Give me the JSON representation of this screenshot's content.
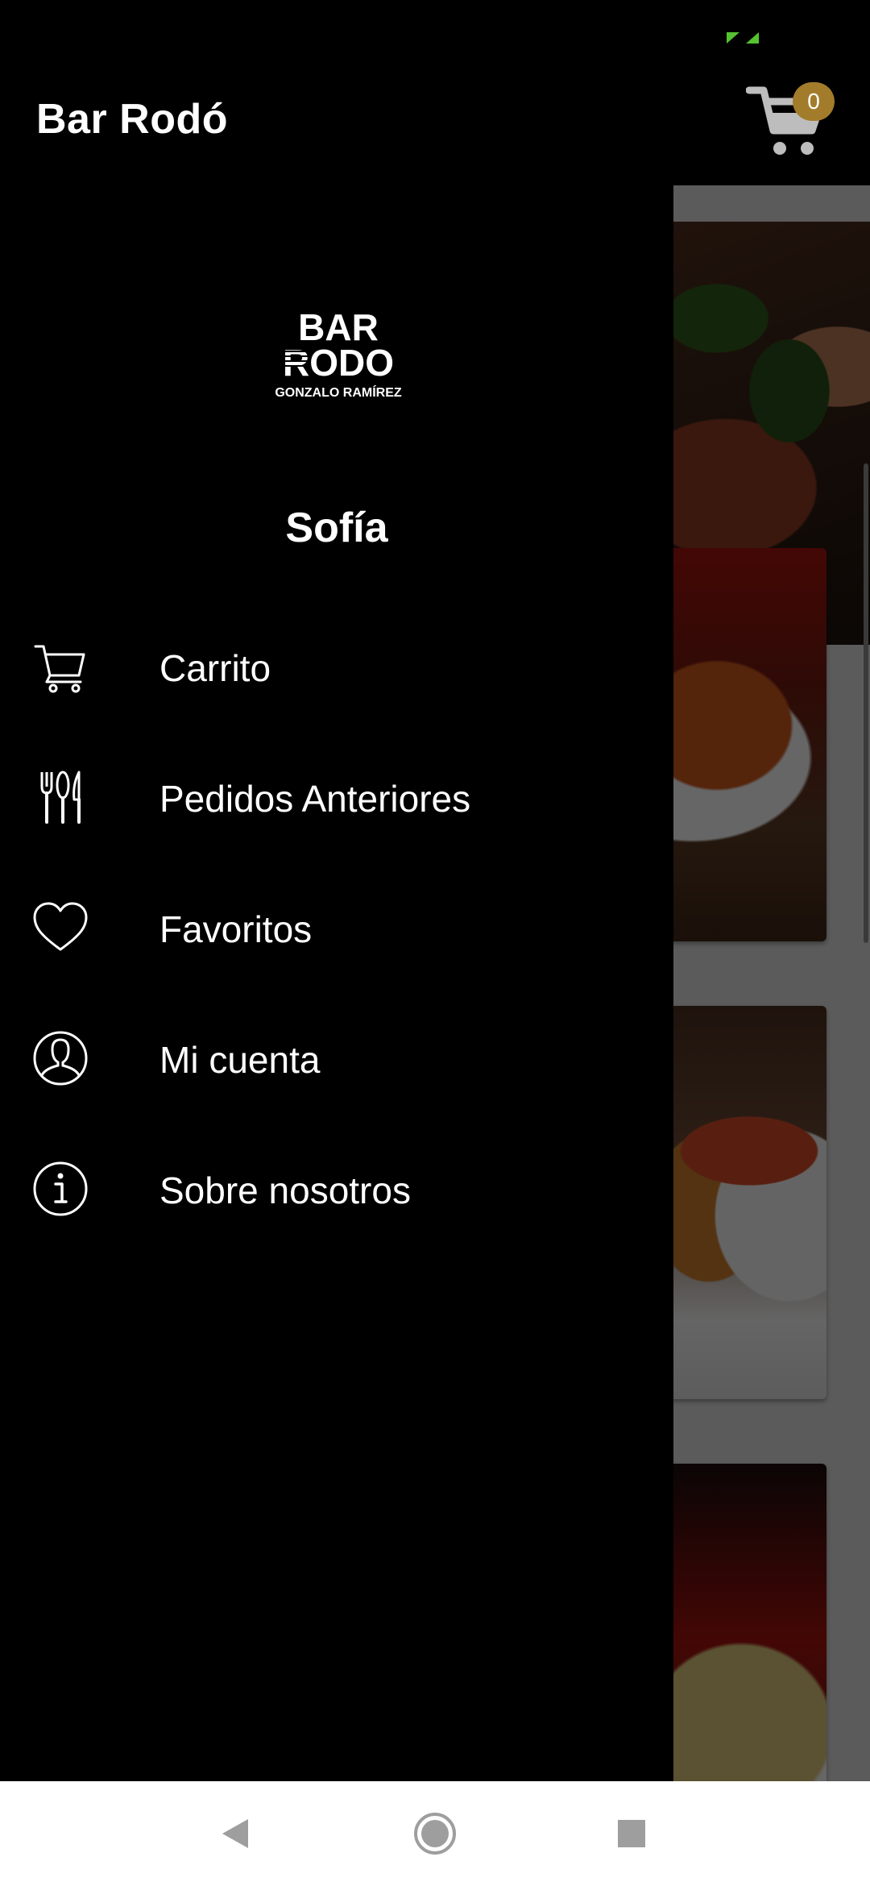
{
  "app": {
    "title": "Bar Rodó"
  },
  "cart": {
    "count": "0"
  },
  "drawer": {
    "logo_text": [
      "BAR",
      "RODO",
      "GONZALO RAMÍREZ"
    ],
    "user_name": "Sofía",
    "items": [
      {
        "label": "Carrito",
        "icon": "cart-icon"
      },
      {
        "label": "Pedidos Anteriores",
        "icon": "fork-knife-icon"
      },
      {
        "label": "Favoritos",
        "icon": "heart-icon"
      },
      {
        "label": "Mi cuenta",
        "icon": "user-icon"
      },
      {
        "label": "Sobre nosotros",
        "icon": "info-icon"
      }
    ]
  },
  "colors": {
    "badge": "#a37c2b",
    "drawer_bg": "#000000",
    "status_icon": "#55c22f"
  },
  "navigation": [
    "back-icon",
    "home-icon",
    "recents-icon"
  ]
}
